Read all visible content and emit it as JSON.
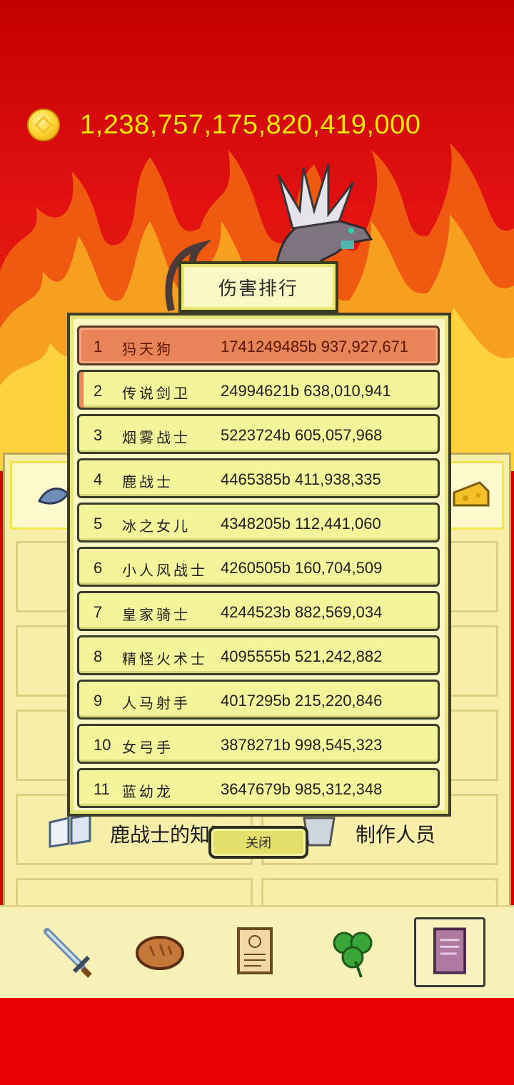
{
  "currency": {
    "icon": "gold-coin-icon",
    "amount": "1,238,757,175,820,419,000"
  },
  "dialog": {
    "title": "伤害排行",
    "close_label": "关闭",
    "rows": [
      {
        "rank": "1",
        "name": "犸天狗",
        "score": "1741249485b 937,927,671"
      },
      {
        "rank": "2",
        "name": "传说剑卫",
        "score": "24994621b 638,010,941"
      },
      {
        "rank": "3",
        "name": "烟雾战士",
        "score": "5223724b 605,057,968"
      },
      {
        "rank": "4",
        "name": "鹿战士",
        "score": "4465385b 411,938,335"
      },
      {
        "rank": "5",
        "name": "冰之女儿",
        "score": "4348205b 112,441,060"
      },
      {
        "rank": "6",
        "name": "小人风战士",
        "score": "4260505b 160,704,509"
      },
      {
        "rank": "7",
        "name": "皇家骑士",
        "score": "4244523b 882,569,034"
      },
      {
        "rank": "8",
        "name": "精怪火术士",
        "score": "4095555b 521,242,882"
      },
      {
        "rank": "9",
        "name": "人马射手",
        "score": "4017295b 215,220,846"
      },
      {
        "rank": "10",
        "name": "女弓手",
        "score": "3878271b 998,545,323"
      },
      {
        "rank": "11",
        "name": "蓝幼龙",
        "score": "3647679b 985,312,348"
      }
    ]
  },
  "menu": {
    "knowledge_label": "鹿战士的知识",
    "credits_label": "制作人员"
  },
  "nav": {
    "items": [
      "sword-icon",
      "bread-icon",
      "scroll-icon",
      "clover-icon",
      "book-icon"
    ],
    "active_index": 4
  },
  "colors": {
    "background_red": "#d40000",
    "gold_text": "#ffe600",
    "panel_yellow": "#f7eeaa",
    "row_yellow": "#f4f49a",
    "top_row_orange": "#e88558"
  }
}
